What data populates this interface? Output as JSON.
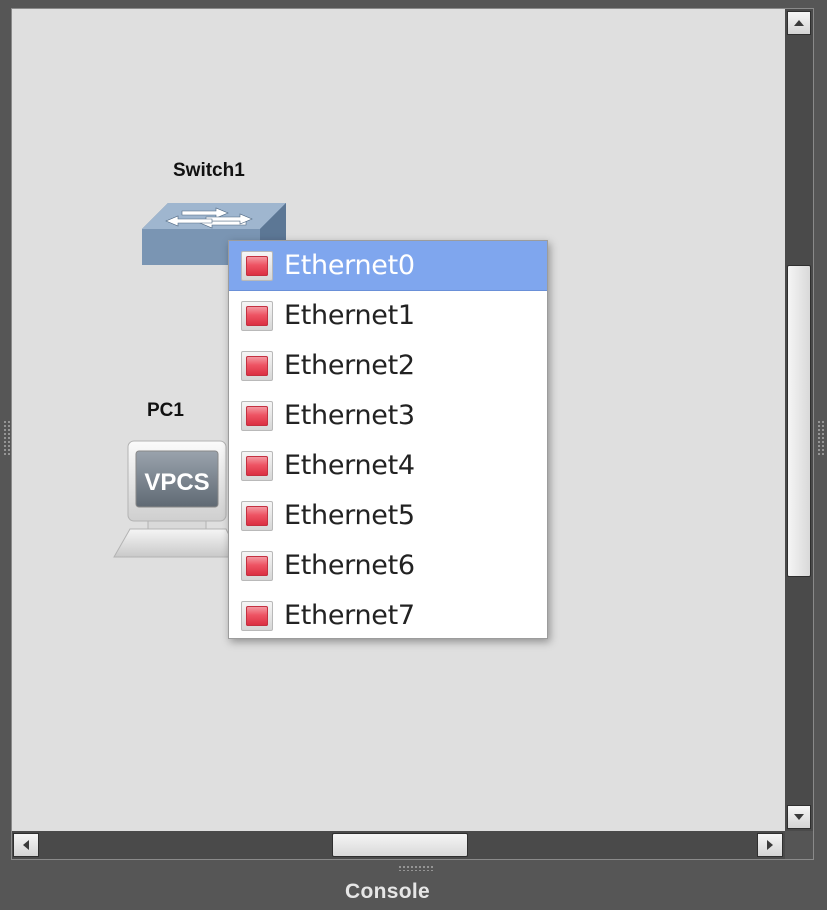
{
  "canvas": {
    "nodes": {
      "switch": {
        "label": "Switch1",
        "icon": "ethernet-switch-icon"
      },
      "pc": {
        "label": "PC1",
        "screen_text": "VPCS",
        "icon": "vpcs-computer-icon"
      }
    }
  },
  "port_menu": {
    "selected_index": 0,
    "status_icon": "port-down-red-led-icon",
    "items": [
      {
        "label": "Ethernet0"
      },
      {
        "label": "Ethernet1"
      },
      {
        "label": "Ethernet2"
      },
      {
        "label": "Ethernet3"
      },
      {
        "label": "Ethernet4"
      },
      {
        "label": "Ethernet5"
      },
      {
        "label": "Ethernet6"
      },
      {
        "label": "Ethernet7"
      }
    ]
  },
  "footer": {
    "console_label": "Console"
  },
  "colors": {
    "selection": "#7fa6ee",
    "canvas_bg": "#dfdfdf",
    "port_down": "#e8394d",
    "chrome": "#565656"
  }
}
